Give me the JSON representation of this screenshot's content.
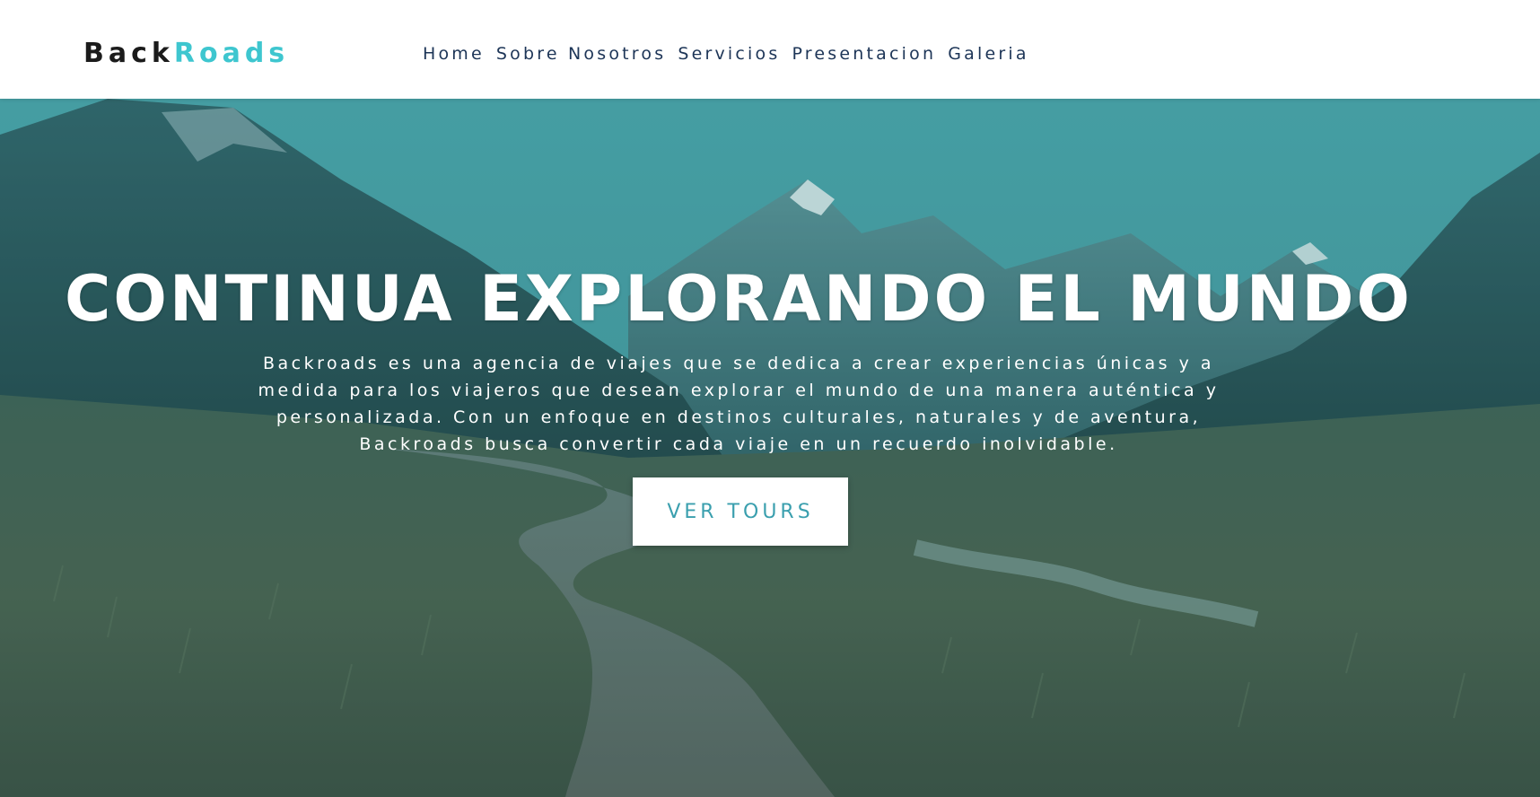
{
  "brand": {
    "first": "Back",
    "second": "Roads",
    "colors": {
      "first": "#1b1b1b",
      "second": "#3ec6cf"
    }
  },
  "nav": {
    "items": [
      {
        "label": "Home"
      },
      {
        "label": "Sobre Nosotros"
      },
      {
        "label": "Servicios"
      },
      {
        "label": "Presentacion"
      },
      {
        "label": "Galeria"
      }
    ]
  },
  "hero": {
    "title": "CONTINUA EXPLORANDO EL MUNDO",
    "description": "Backroads es una agencia de viajes que se dedica a crear experiencias únicas y a medida para los viajeros que desean explorar el mundo de una manera auténtica y personalizada. Con un enfoque en destinos culturales, naturales y de aventura, Backroads busca convertir cada viaje en un recuerdo inolvidable.",
    "button_label": "VER TOURS",
    "background_image": "mountain-valley-boardwalk",
    "colors": {
      "overlay": "#3a9fa5",
      "button_text": "#3a9fae"
    }
  }
}
